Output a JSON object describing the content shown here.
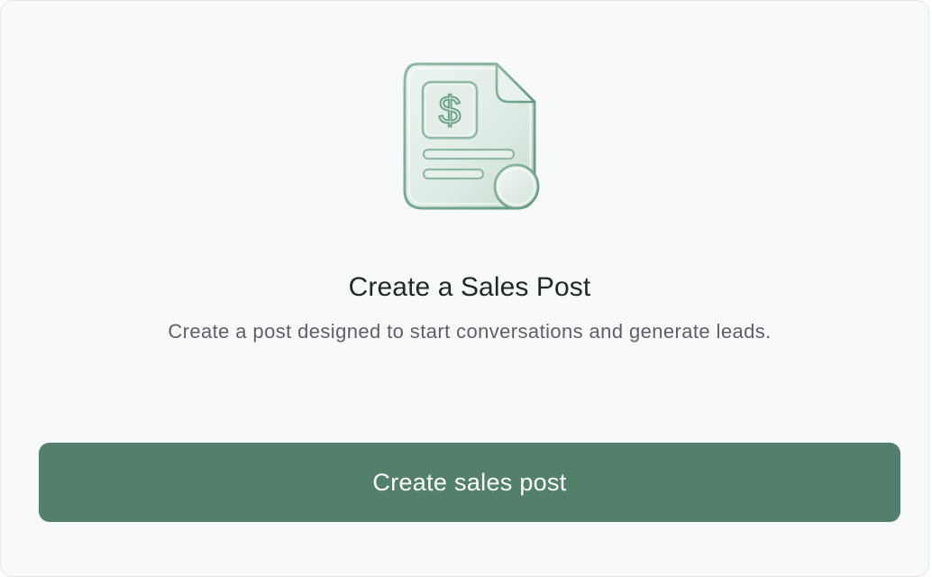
{
  "card": {
    "icon": "sales-document-dollar-icon",
    "title": "Create a Sales Post",
    "description": "Create a post designed to start conversations and generate leads.",
    "cta_label": "Create sales post"
  },
  "colors": {
    "button_bg": "#52806a",
    "button_text": "#ffffff",
    "title": "#1d2b22",
    "description": "#5d6166",
    "card_bg": "#f8f9fb",
    "icon_tint": "#b7d4c4"
  }
}
